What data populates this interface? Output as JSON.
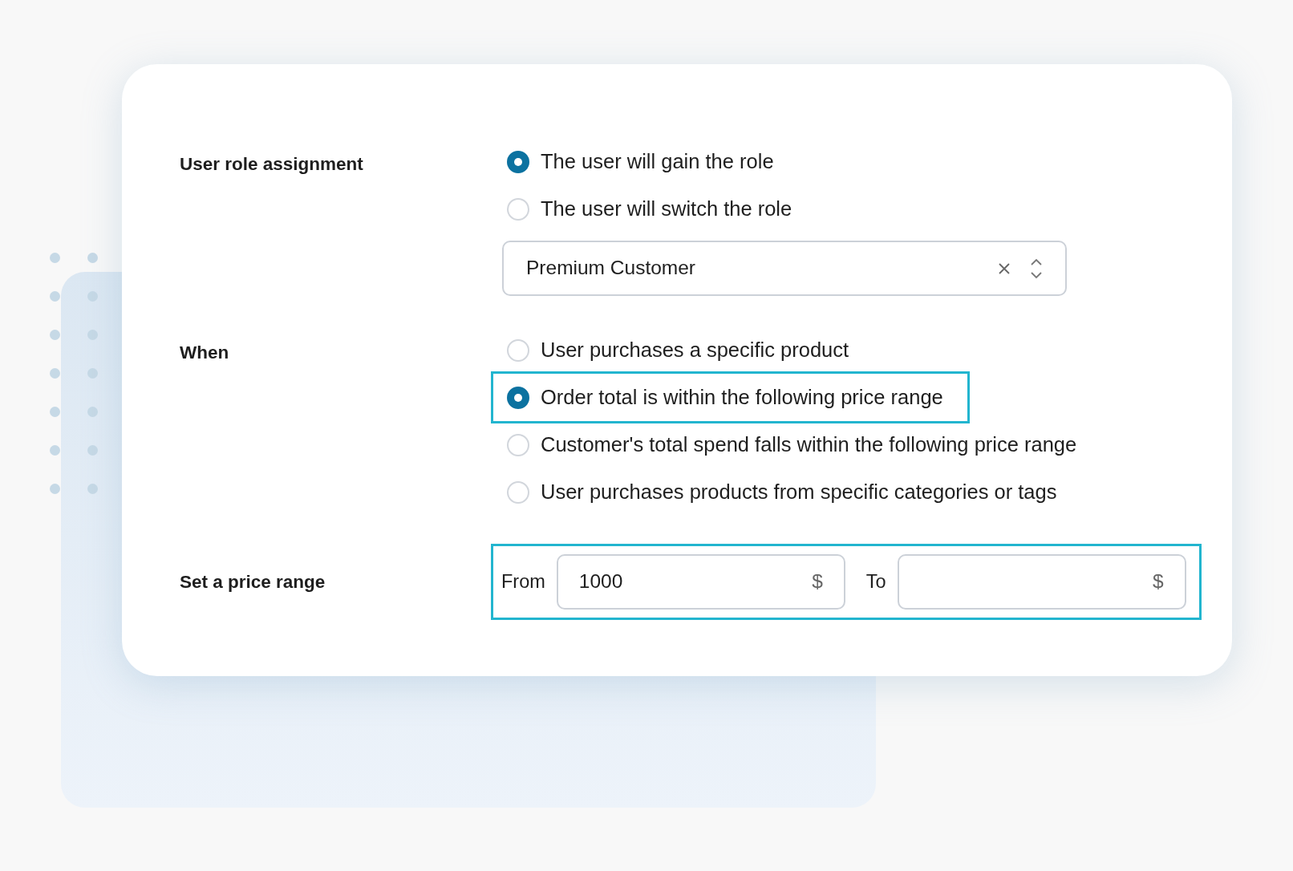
{
  "role_assignment": {
    "label": "User role assignment",
    "options": [
      {
        "label": "The user will gain the role",
        "selected": true
      },
      {
        "label": "The user will switch the role",
        "selected": false
      }
    ],
    "role_select": {
      "value": "Premium Customer"
    }
  },
  "when": {
    "label": "When",
    "options": [
      {
        "label": "User purchases a specific product",
        "selected": false,
        "highlighted": false
      },
      {
        "label": "Order total is within the following price range",
        "selected": true,
        "highlighted": true
      },
      {
        "label": "Customer's total spend falls within the following price range",
        "selected": false,
        "highlighted": false
      },
      {
        "label": "User purchases products from specific categories or tags",
        "selected": false,
        "highlighted": false
      }
    ]
  },
  "price_range": {
    "label": "Set a price range",
    "highlighted": true,
    "fields": [
      {
        "label": "From",
        "value": "1000",
        "unit": "$"
      },
      {
        "label": "To",
        "unit": "$"
      }
    ]
  }
}
